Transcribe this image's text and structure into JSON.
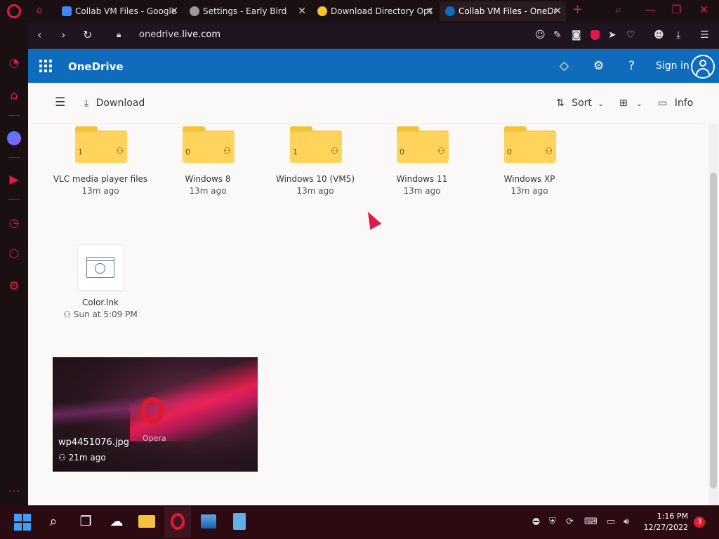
{
  "browser": {
    "tabs": [
      {
        "label": "Collab VM Files - Google",
        "favicon_color": "#4285f4"
      },
      {
        "label": "Settings - Early Bird",
        "favicon_color": "#dddddd"
      },
      {
        "label": "Download Directory Opt",
        "favicon_color": "#f4c430"
      },
      {
        "label": "Collab VM Files - OneDr",
        "favicon_color": "#0f6cbd",
        "active": true
      }
    ],
    "new_tab": "+",
    "url_host": "onedrive.",
    "url_domain": "live.com",
    "accent": "#e0194b"
  },
  "onedrive": {
    "app_title": "OneDrive",
    "sign_in": "Sign in",
    "header_color": "#0f6cbd",
    "command_bar": {
      "download": "Download",
      "sort": "Sort",
      "info": "Info"
    },
    "folders": [
      {
        "name": "VLC media player files",
        "count": "1",
        "modified": "13m ago"
      },
      {
        "name": "Windows 8",
        "count": "0",
        "modified": "13m ago"
      },
      {
        "name": "Windows 10 (VM5)",
        "count": "1",
        "modified": "13m ago"
      },
      {
        "name": "Windows 11",
        "count": "0",
        "modified": "13m ago"
      },
      {
        "name": "Windows XP",
        "count": "0",
        "modified": "13m ago"
      }
    ],
    "files": [
      {
        "name": "Color.lnk",
        "modified": "Sun at 5:09 PM"
      }
    ],
    "images": [
      {
        "name": "wp4451076.jpg",
        "modified": "21m ago",
        "watermark": "Opera"
      }
    ]
  },
  "taskbar": {
    "time": "1:16 PM",
    "date": "12/27/2022",
    "notifications": "3"
  }
}
